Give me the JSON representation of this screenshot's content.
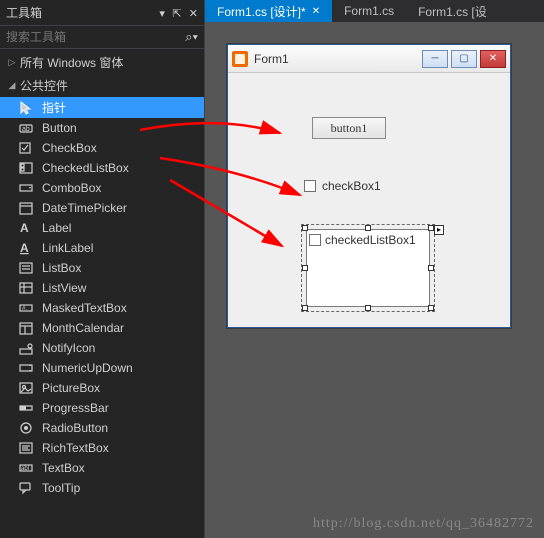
{
  "toolbox": {
    "title": "工具箱",
    "search_placeholder": "搜索工具箱",
    "categories": [
      {
        "arrow": "▷",
        "label": "所有 Windows 窗体",
        "expanded": false
      },
      {
        "arrow": "◢",
        "label": "公共控件",
        "expanded": true
      }
    ],
    "items": [
      {
        "label": "指针",
        "icon": "pointer-icon",
        "selected": true
      },
      {
        "label": "Button",
        "icon": "button-icon"
      },
      {
        "label": "CheckBox",
        "icon": "checkbox-icon"
      },
      {
        "label": "CheckedListBox",
        "icon": "checkedlistbox-icon"
      },
      {
        "label": "ComboBox",
        "icon": "combobox-icon"
      },
      {
        "label": "DateTimePicker",
        "icon": "datetimepicker-icon"
      },
      {
        "label": "Label",
        "icon": "label-icon"
      },
      {
        "label": "LinkLabel",
        "icon": "linklabel-icon"
      },
      {
        "label": "ListBox",
        "icon": "listbox-icon"
      },
      {
        "label": "ListView",
        "icon": "listview-icon"
      },
      {
        "label": "MaskedTextBox",
        "icon": "maskedtextbox-icon"
      },
      {
        "label": "MonthCalendar",
        "icon": "monthcalendar-icon"
      },
      {
        "label": "NotifyIcon",
        "icon": "notifyicon-icon"
      },
      {
        "label": "NumericUpDown",
        "icon": "numericupdown-icon"
      },
      {
        "label": "PictureBox",
        "icon": "picturebox-icon"
      },
      {
        "label": "ProgressBar",
        "icon": "progressbar-icon"
      },
      {
        "label": "RadioButton",
        "icon": "radiobutton-icon"
      },
      {
        "label": "RichTextBox",
        "icon": "richtextbox-icon"
      },
      {
        "label": "TextBox",
        "icon": "textbox-icon"
      },
      {
        "label": "ToolTip",
        "icon": "tooltip-icon"
      }
    ]
  },
  "tabs": [
    {
      "label": "Form1.cs [设计]*",
      "active": true,
      "glyph": "✕"
    },
    {
      "label": "Form1.cs",
      "active": false
    },
    {
      "label": "Form1.cs [设",
      "active": false
    }
  ],
  "form": {
    "title": "Form1",
    "button_text": "button1",
    "checkbox_text": "checkBox1",
    "checkedlistbox_text": "checkedListBox1"
  },
  "watermark": "http://blog.csdn.net/qq_36482772"
}
